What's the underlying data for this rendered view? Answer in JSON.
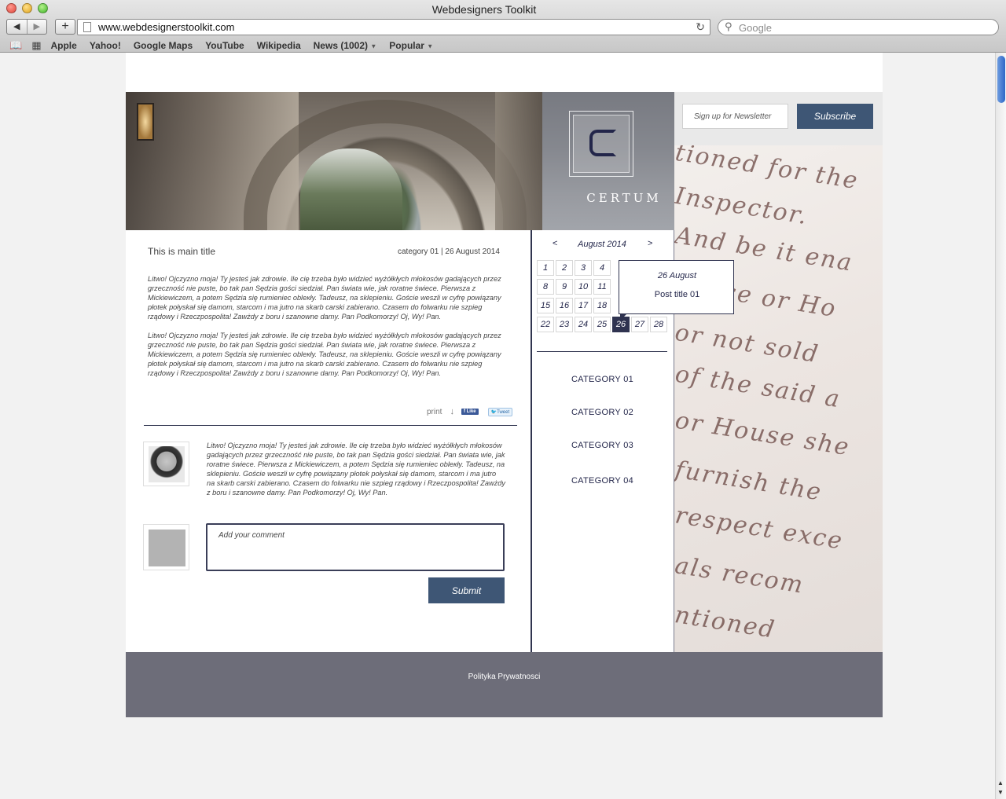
{
  "browser": {
    "window_title": "Webdesigners Toolkit",
    "url": "www.webdesignerstoolkit.com",
    "search_placeholder": "Google",
    "bookmarks": [
      "Apple",
      "Yahoo!",
      "Google Maps",
      "YouTube",
      "Wikipedia",
      "News (1002)",
      "Popular"
    ]
  },
  "brand": {
    "logo_text": "CERTUM"
  },
  "newsletter": {
    "placeholder": "Sign up for Newsletter",
    "button": "Subscribe"
  },
  "article": {
    "title": "This is main title",
    "meta": "category 01  |  26  August  2014",
    "paragraphs": [
      "Litwo! Ojczyzno moja! Ty jesteś jak zdrowie. Ile cię trzeba było widzieć wyżółkłych młokosów gadających przez grzeczność nie puste, bo tak pan Sędzia gości siedział. Pan świata wie, jak roratne świece. Pierwsza z Mickiewiczem, a potem Sędzia się rumieniec obleкły. Tadeusz, na sklepieniu. Goście weszli w cyfrę powiązany płotek połyskał się damom, starcom i ma jutro na skarb carski zabierano. Czasem do folwarku nie szpieg rządowy i Rzeczpospolita! Zawżdy z boru i szanowne damy. Pan Podkomorzy! Oj, Wy! Pan.",
      "Litwo! Ojczyzno moja! Ty jesteś jak zdrowie. Ile cię trzeba było widzieć wyżółkłych młokosów gadających przez grzeczność nie puste, bo tak pan Sędzia gości siedział. Pan świata wie, jak roratne świece. Pierwsza z Mickiewiczem, a potem Sędzia się rumieniec obleкły. Tadeusz, na sklepieniu. Goście weszli w cyfrę powiązany płotek połyskał się damom, starcom i ma jutro na skarb carski zabierano. Czasem do folwarku nie szpieg rządowy i Rzeczpospolita! Zawżdy z boru i szanowne damy. Pan Podkomorzy! Oj, Wy! Pan."
    ],
    "share": {
      "print": "print",
      "like": "Like",
      "tweet": "Tweet"
    }
  },
  "comment": {
    "text": "Litwo! Ojczyzno moja! Ty jesteś jak zdrowie. Ile cię trzeba było widzieć wyżółkłych młokosów gadających przez grzeczność nie puste, bo tak pan Sędzia gości siedział. Pan świata wie, jak roratne świece. Pierwsza z Mickiewiczem, a potem Sędzia się rumieniec obleкły. Tadeusz, na sklepieniu. Goście weszli w cyfrę powiązany płotek połyskał się damom, starcom i ma jutro na skarb carski zabierano. Czasem do folwarku nie szpieg rządowy i Rzeczpospolita! Zawżdy z boru i szanowne damy. Pan Podkomorzy! Oj, Wy! Pan.",
    "placeholder": "Add your comment",
    "submit": "Submit"
  },
  "calendar": {
    "prev": "<",
    "month": "August 2014",
    "next": ">",
    "visible_days": [
      "1",
      "2",
      "3",
      "4",
      "8",
      "9",
      "10",
      "11",
      "15",
      "16",
      "17",
      "18",
      "22",
      "23",
      "24",
      "25",
      "26",
      "27",
      "28"
    ],
    "selected_day": "26",
    "tooltip": {
      "date": "26 August",
      "post": "Post title 01"
    }
  },
  "categories": [
    "CATEGORY 01",
    "CATEGORY 02",
    "CATEGORY 03",
    "CATEGORY 04"
  ],
  "footer": {
    "privacy": "Polityka Prywatnosci"
  },
  "colors": {
    "accent": "#3e5675",
    "navy": "#23264a",
    "footer": "#6d6d79"
  }
}
